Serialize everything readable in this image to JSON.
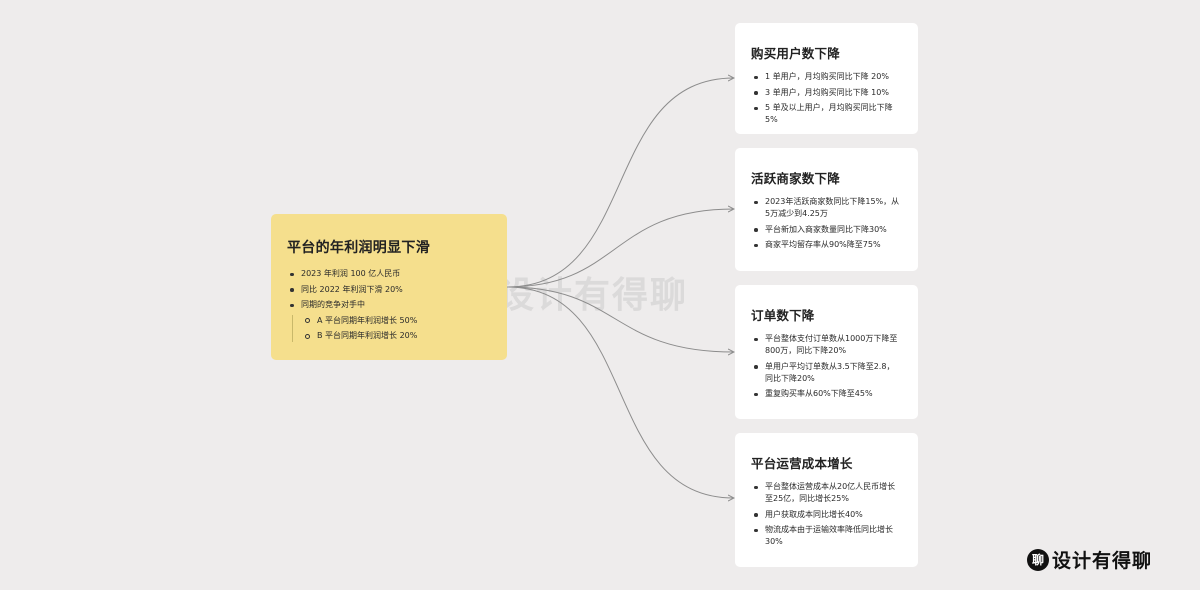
{
  "root": {
    "title": "平台的年利润明显下滑",
    "items": [
      "2023 年利润 100 亿人民币",
      "同比 2022 年利润下滑 20%",
      "同期的竞争对手中"
    ],
    "subitems": [
      "A 平台同期年利润增长 50%",
      "B 平台同期年利润增长 20%"
    ]
  },
  "cards": [
    {
      "title": "购买用户数下降",
      "items": [
        "1 单用户，月均购买同比下降 20%",
        "3 单用户，月均购买同比下降 10%",
        "5 单及以上用户，月均购买同比下降 5%"
      ]
    },
    {
      "title": "活跃商家数下降",
      "items": [
        "2023年活跃商家数同比下降15%，从5万减少到4.25万",
        "平台新加入商家数量同比下降30%",
        "商家平均留存率从90%降至75%"
      ]
    },
    {
      "title": "订单数下降",
      "items": [
        "平台整体支付订单数从1000万下降至800万，同比下降20%",
        "单用户平均订单数从3.5下降至2.8，同比下降20%",
        "重复购买率从60%下降至45%"
      ]
    },
    {
      "title": "平台运营成本增长",
      "items": [
        "平台整体运营成本从20亿人民币增长至25亿，同比增长25%",
        "用户获取成本同比增长40%",
        "物流成本由于运输效率降低同比增长30%"
      ]
    }
  ],
  "watermark": {
    "badge": "聊",
    "text": "设计有得聊"
  },
  "colors": {
    "background": "#eeecec",
    "root_fill": "#f5df8d",
    "card_fill": "#ffffff",
    "connector": "#8c8c8c"
  }
}
